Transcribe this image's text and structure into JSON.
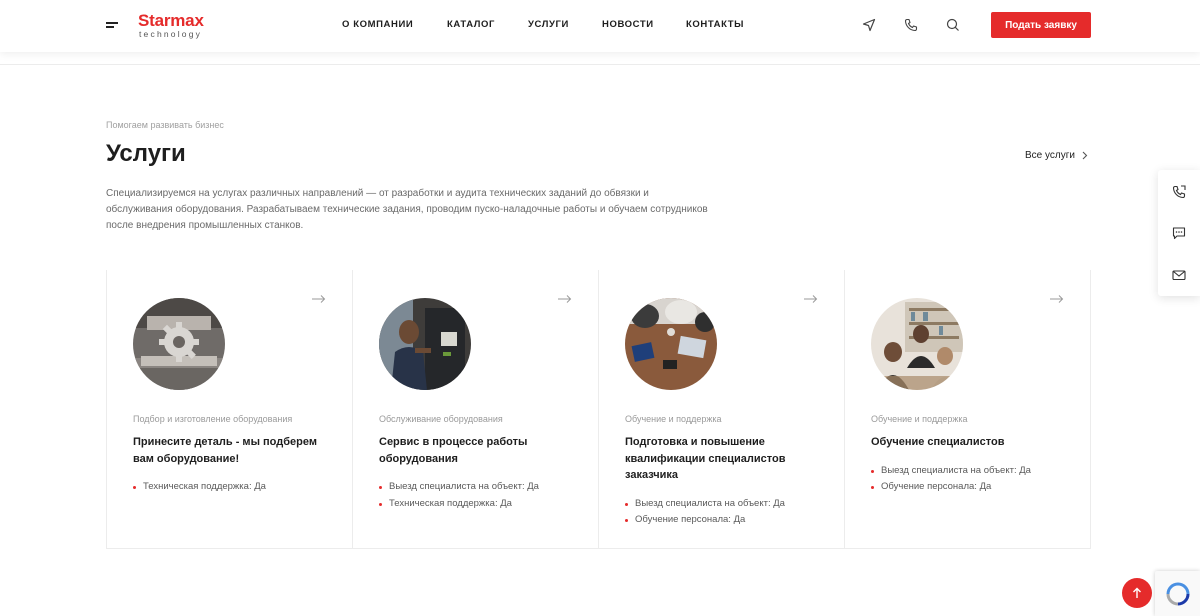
{
  "header": {
    "logo_main": "Starmax",
    "logo_sub": "technology",
    "nav": [
      {
        "label": "О КОМПАНИИ"
      },
      {
        "label": "КАТАЛОГ"
      },
      {
        "label": "УСЛУГИ"
      },
      {
        "label": "НОВОСТИ"
      },
      {
        "label": "КОНТАКТЫ"
      }
    ],
    "cta_label": "Подать заявку",
    "icons": [
      "location-icon",
      "phone-icon",
      "search-icon"
    ]
  },
  "section": {
    "eyebrow": "Помогаем развивать бизнес",
    "title": "Услуги",
    "all_link": "Все услуги",
    "intro": "Специализируемся на услугах различных направлений — от разработки и аудита технических заданий до обвязки и обслуживания оборудования. Разрабатываем технические задания, проводим пуско-наладочные работы и обучаем сотрудников после внедрения промышленных станков."
  },
  "cards": [
    {
      "category": "Подбор и изготовление оборудования",
      "title": "Принесите деталь - мы подберем вам оборудование!",
      "features": [
        "Техническая поддержка: Да"
      ]
    },
    {
      "category": "Обслуживание оборудования",
      "title": "Сервис в процессе работы оборудования",
      "features": [
        "Выезд специалиста на объект: Да",
        "Техническая поддержка: Да"
      ]
    },
    {
      "category": "Обучение и поддержка",
      "title": "Подготовка и повышение квалификации специалистов заказчика",
      "features": [
        "Выезд специалиста на объект: Да",
        "Обучение персонала: Да"
      ]
    },
    {
      "category": "Обучение и поддержка",
      "title": "Обучение специалистов",
      "features": [
        "Выезд специалиста на объект: Да",
        "Обучение персонала: Да"
      ]
    }
  ],
  "colors": {
    "accent": "#e52b2b",
    "text": "#1e1e1e",
    "muted": "#9a9a9a",
    "border": "#ececec"
  }
}
